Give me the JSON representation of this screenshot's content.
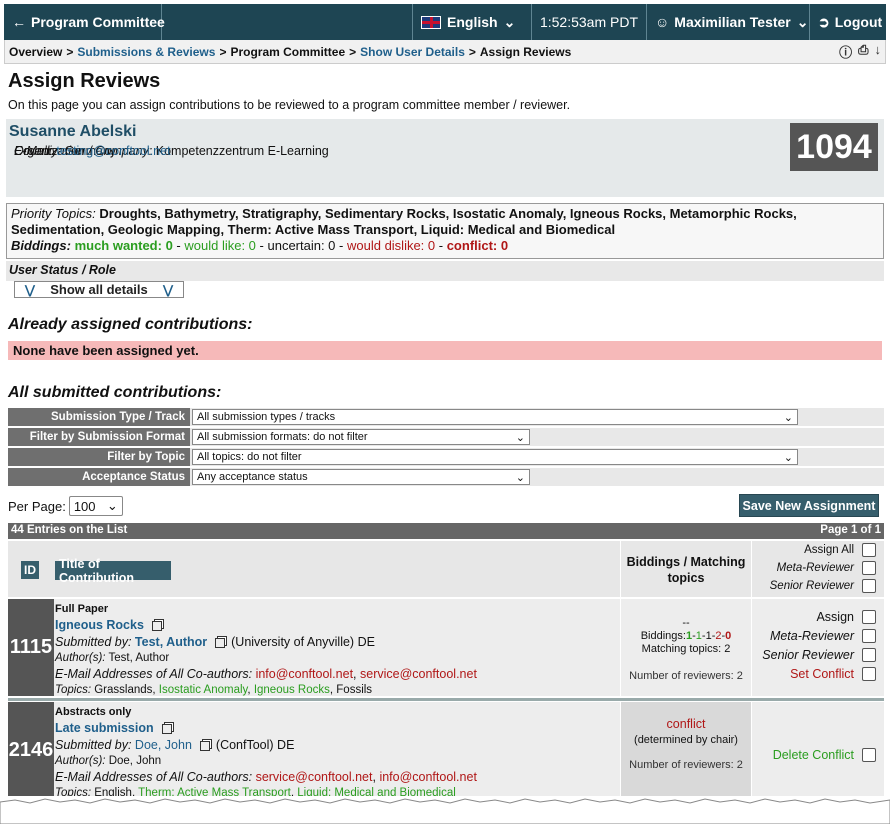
{
  "topbar": {
    "back_label": "Program Committee",
    "language": "English",
    "time": "1:52:53am PDT",
    "user": "Maximilian Tester",
    "logout": "Logout"
  },
  "breadcrumb": [
    "Overview",
    "Submissions & Reviews",
    "Program Committee",
    "Show User Details",
    "Assign Reviews"
  ],
  "page": {
    "title": "Assign Reviews",
    "intro": "On this page you can assign contributions to be reviewed to a program committee member / reviewer."
  },
  "user": {
    "name": "Susanne Abelski",
    "org_label": "Organization / Company:",
    "org": "Kompetenzzentrum E-Learning",
    "country_label": "Country:",
    "country": "Germany",
    "email_label": "E-Mail:",
    "email": "testing@conftool.net",
    "id": "1094"
  },
  "priority": {
    "label": "Priority Topics:",
    "topics": "Droughts, Bathymetry, Stratigraphy, Sedimentary Rocks, Isostatic Anomaly, Igneous Rocks, Metamorphic Rocks, Sedimentation, Geologic Mapping, Therm: Active Mass Transport, Liquid: Medical and Biomedical",
    "biddings_label": "Biddings:",
    "much_wanted": "much wanted: 0",
    "would_like": "would like: 0",
    "uncertain": "uncertain: 0",
    "would_dislike": "would dislike: 0",
    "conflict": "conflict: 0",
    "sep": " - "
  },
  "status_role": "User Status / Role",
  "show_all": "Show all details",
  "assigned": {
    "heading": "Already assigned contributions:",
    "none": "None have been assigned yet."
  },
  "submitted": {
    "heading": "All submitted contributions:"
  },
  "filters": [
    {
      "label": "Submission Type / Track",
      "value": "All submission types / tracks"
    },
    {
      "label": "Filter by Submission Format",
      "value": "All submission formats: do not filter"
    },
    {
      "label": "Filter by Topic",
      "value": "All topics: do not filter"
    },
    {
      "label": "Acceptance Status",
      "value": "Any acceptance status"
    }
  ],
  "per_page": {
    "label": "Per Page:",
    "value": "100"
  },
  "save_button": "Save New Assignment",
  "list": {
    "entries": "44 Entries on the List",
    "page": "Page 1 of 1"
  },
  "table_head": {
    "id": "ID",
    "title": "Title of Contribution",
    "biddings": "Biddings / Matching topics",
    "assign_all": "Assign All",
    "meta_reviewer": "Meta-Reviewer",
    "senior_reviewer": "Senior Reviewer"
  },
  "rows": [
    {
      "id": "1115",
      "type": "Full Paper",
      "title": "Igneous Rocks",
      "submitted_by_label": "Submitted by:",
      "submitter": "Test, Author",
      "affiliation": "(University of Anyville) DE",
      "authors_label": "Author(s):",
      "authors": "Test, Author",
      "emails_label": "E-Mail Addresses of All Co-authors:",
      "email1": "info@conftool.net",
      "email2": "service@conftool.net",
      "topics_label": "Topics:",
      "topic1": "Grasslands",
      "topic2": "Isostatic Anomaly",
      "topic3": "Igneous Rocks",
      "topic4": "Fossils",
      "bid_dash": "--",
      "biddings_label": "Biddings:",
      "bid_values": [
        "1",
        "1",
        "1",
        "2",
        "0"
      ],
      "matching": "Matching topics: 2",
      "reviewers": "Number of reviewers: 2",
      "assign": "Assign",
      "meta": "Meta-Reviewer",
      "senior": "Senior Reviewer",
      "set_conflict": "Set Conflict"
    },
    {
      "id": "2146",
      "type": "Abstracts only",
      "title": "Late submission",
      "submitted_by_label": "Submitted by:",
      "submitter": "Doe, John",
      "affiliation": "(ConfTool) DE",
      "authors_label": "Author(s):",
      "authors": "Doe, John",
      "emails_label": "E-Mail Addresses of All Co-authors:",
      "email1": "service@conftool.net",
      "email2": "info@conftool.net",
      "topics_label": "Topics:",
      "topic1": "English",
      "topic2": "Therm: Active Mass Transport",
      "topic3": "Liquid: Medical and Biomedical",
      "conflict": "conflict",
      "determined": "(determined by chair)",
      "reviewers": "Number of reviewers: 2",
      "delete_conflict": "Delete Conflict"
    }
  ],
  "colors": {
    "topbar": "#1e4553",
    "accent": "#365e6c",
    "link": "#1f5f8b",
    "green": "#2a9d1f",
    "red": "#b01717",
    "alert_bg": "#f6b9b9"
  }
}
